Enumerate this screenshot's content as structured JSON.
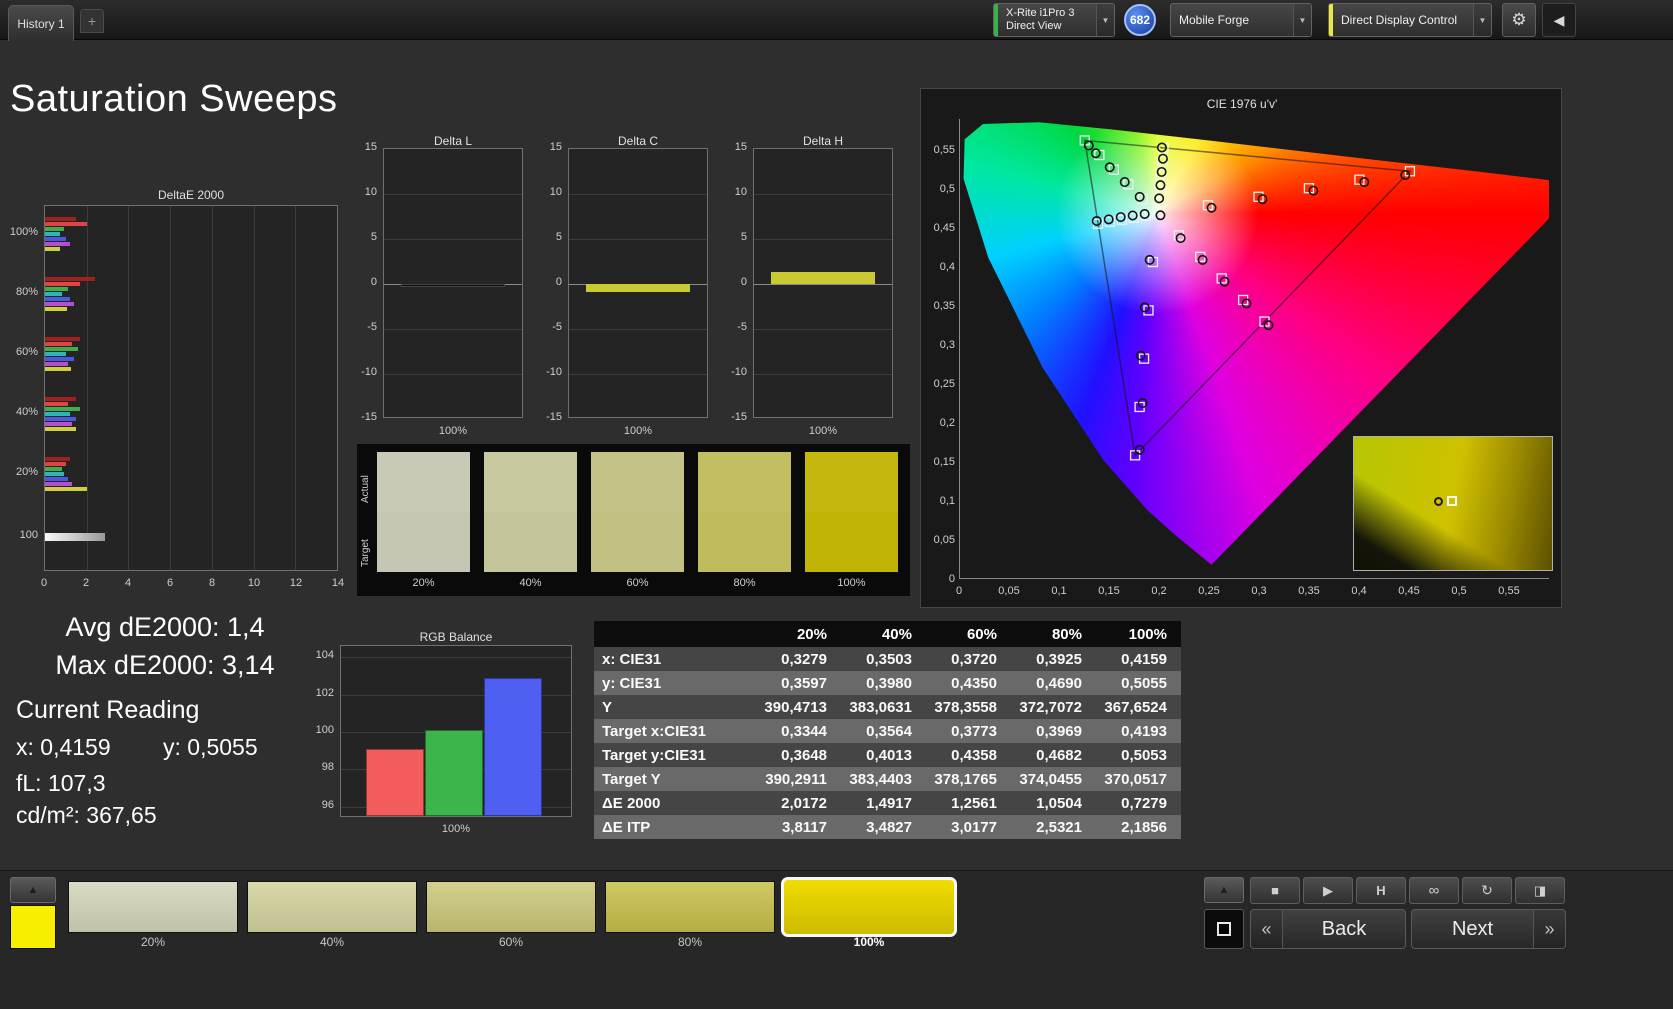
{
  "icons": {
    "plus": "+",
    "caret_down": "▼",
    "gear": "⚙",
    "collapse_left": "◀",
    "up_arrow": "▲",
    "stop": "■",
    "play": "▶",
    "histogram": "H",
    "continuous": "∞",
    "refresh": "↻",
    "half_square": "◨",
    "back_chevron": "«",
    "next_chevron": "»"
  },
  "top_bar": {
    "tab": "History 1",
    "meter": {
      "line1": "X-Rite i1Pro 3",
      "line2": "Direct View",
      "accent": "#35b44a"
    },
    "badge": "682",
    "source": {
      "label": "Mobile Forge"
    },
    "control": {
      "label": "Direct Display Control",
      "accent": "#e8e840"
    }
  },
  "page": {
    "title": "Saturation Sweeps"
  },
  "chart_data": [
    {
      "type": "bar",
      "title": "DeltaE 2000",
      "orientation": "horizontal",
      "groups": [
        "100%",
        "80%",
        "60%",
        "40%",
        "20%",
        "100"
      ],
      "series_colors": [
        "#a01f1f",
        "#e04545",
        "#3fae4a",
        "#2fb5b5",
        "#4a5ae0",
        "#b44fd0",
        "#cfcf40"
      ],
      "values": [
        [
          1.5,
          2.0,
          0.9,
          0.7,
          1.0,
          1.2,
          0.73
        ],
        [
          2.4,
          1.7,
          1.1,
          0.8,
          1.2,
          1.4,
          1.05
        ],
        [
          1.7,
          1.3,
          1.6,
          1.0,
          1.4,
          1.1,
          1.26
        ],
        [
          1.5,
          1.1,
          1.7,
          1.2,
          1.5,
          1.3,
          1.49
        ],
        [
          1.2,
          1.0,
          0.8,
          0.9,
          1.1,
          1.3,
          2.02
        ],
        [
          2.9
        ]
      ],
      "xlim": [
        0,
        14
      ],
      "xticks": [
        0,
        2,
        4,
        6,
        8,
        10,
        12,
        14
      ]
    },
    {
      "type": "bar",
      "title": "Delta L",
      "value": -0.3,
      "color": "#0c0c0c",
      "outline": true,
      "ylim": [
        -15,
        15
      ],
      "yticks": [
        15,
        10,
        5,
        0,
        -5,
        -10,
        -15
      ],
      "xlabel": "100%"
    },
    {
      "type": "bar",
      "title": "Delta C",
      "value": -0.9,
      "color": "#c9c932",
      "outline": false,
      "ylim": [
        -15,
        15
      ],
      "yticks": [
        15,
        10,
        5,
        0,
        -5,
        -10,
        -15
      ],
      "xlabel": "100%"
    },
    {
      "type": "bar",
      "title": "Delta H",
      "value": 1.3,
      "color": "#c9c932",
      "outline": false,
      "ylim": [
        -15,
        15
      ],
      "yticks": [
        15,
        10,
        5,
        0,
        -5,
        -10,
        -15
      ],
      "xlabel": "100%"
    },
    {
      "type": "bar",
      "title": "RGB Balance",
      "categories": [
        "Red",
        "Green",
        "Blue"
      ],
      "values": [
        99,
        100,
        102.8
      ],
      "colors": [
        "#f25c5c",
        "#3cb54a",
        "#4f5ff2"
      ],
      "ylim": [
        96,
        104
      ],
      "yticks": [
        96,
        98,
        100,
        102,
        104
      ],
      "xlabel": "100%"
    },
    {
      "type": "scatter",
      "title": "CIE 1976 u'v'",
      "xlim": [
        0,
        0.59
      ],
      "ylim": [
        0,
        0.59
      ],
      "tick_values": [
        0,
        0.05,
        0.1,
        0.15,
        0.2,
        0.25,
        0.3,
        0.35,
        0.4,
        0.45,
        0.5,
        0.55
      ],
      "tick_labels": [
        "0",
        "0,05",
        "0,1",
        "0,15",
        "0,2",
        "0,25",
        "0,3",
        "0,35",
        "0,4",
        "0,45",
        "0,5",
        "0,55"
      ],
      "white_point": [
        0.1978,
        0.4683
      ],
      "gamut_triangle": [
        [
          0.4507,
          0.5229
        ],
        [
          0.125,
          0.5625
        ],
        [
          0.1754,
          0.1579
        ]
      ],
      "sweeps": [
        {
          "name": "red",
          "targets": [
            [
              0.2484,
              0.4792
            ],
            [
              0.299,
              0.4901
            ],
            [
              0.3495,
              0.5011
            ],
            [
              0.4001,
              0.512
            ],
            [
              0.4507,
              0.5229
            ]
          ],
          "measured": [
            [
              0.252,
              0.476
            ],
            [
              0.303,
              0.487
            ],
            [
              0.354,
              0.498
            ],
            [
              0.405,
              0.509
            ],
            [
              0.446,
              0.518
            ]
          ]
        },
        {
          "name": "green",
          "targets": [
            [
              0.1832,
              0.4871
            ],
            [
              0.1687,
              0.506
            ],
            [
              0.1541,
              0.5248
            ],
            [
              0.1396,
              0.5437
            ],
            [
              0.125,
              0.5625
            ]
          ],
          "measured": [
            [
              0.18,
              0.49
            ],
            [
              0.165,
              0.509
            ],
            [
              0.15,
              0.528
            ],
            [
              0.136,
              0.546
            ],
            [
              0.129,
              0.556
            ]
          ]
        },
        {
          "name": "blue",
          "targets": [
            [
              0.1933,
              0.4062
            ],
            [
              0.1888,
              0.3441
            ],
            [
              0.1844,
              0.2821
            ],
            [
              0.1799,
              0.22
            ],
            [
              0.1754,
              0.1579
            ]
          ],
          "measured": [
            [
              0.19,
              0.409
            ],
            [
              0.185,
              0.348
            ],
            [
              0.181,
              0.286
            ],
            [
              0.183,
              0.225
            ],
            [
              0.18,
              0.165
            ]
          ]
        },
        {
          "name": "cyan",
          "targets": [
            [
              0.1859,
              0.4657
            ],
            [
              0.174,
              0.4631
            ],
            [
              0.1621,
              0.4606
            ],
            [
              0.1502,
              0.458
            ],
            [
              0.1383,
              0.4554
            ]
          ],
          "measured": [
            [
              0.185,
              0.468
            ],
            [
              0.173,
              0.466
            ],
            [
              0.161,
              0.464
            ],
            [
              0.149,
              0.461
            ],
            [
              0.137,
              0.459
            ]
          ]
        },
        {
          "name": "magenta",
          "targets": [
            [
              0.2192,
              0.4406
            ],
            [
              0.2407,
              0.4129
            ],
            [
              0.2621,
              0.3852
            ],
            [
              0.2836,
              0.3575
            ],
            [
              0.305,
              0.3298
            ]
          ],
          "measured": [
            [
              0.221,
              0.437
            ],
            [
              0.243,
              0.409
            ],
            [
              0.265,
              0.381
            ],
            [
              0.287,
              0.353
            ],
            [
              0.309,
              0.325
            ]
          ]
        },
        {
          "name": "yellow",
          "targets": [
            [
              0.199,
              0.4852
            ],
            [
              0.2002,
              0.5021
            ],
            [
              0.2015,
              0.5191
            ],
            [
              0.2027,
              0.536
            ],
            [
              0.2039,
              0.5529
            ]
          ],
          "measured": [
            [
              0.1995,
              0.488
            ],
            [
              0.2008,
              0.505
            ],
            [
              0.202,
              0.522
            ],
            [
              0.2033,
              0.539
            ],
            [
              0.2023,
              0.5534
            ]
          ]
        }
      ]
    }
  ],
  "swatch_strip": {
    "row_labels": [
      "Actual",
      "Target"
    ],
    "items": [
      {
        "label": "20%",
        "actual": "#c9cab6",
        "target": "#c6c7b2"
      },
      {
        "label": "40%",
        "actual": "#c8c8a0",
        "target": "#c5c59c"
      },
      {
        "label": "60%",
        "actual": "#c5c287",
        "target": "#c2c083"
      },
      {
        "label": "80%",
        "actual": "#c3be62",
        "target": "#c0bb5c"
      },
      {
        "label": "100%",
        "actual": "#c6b70e",
        "target": "#c2b406"
      }
    ]
  },
  "readings": {
    "avg": "Avg dE2000: 1,4",
    "max": "Max dE2000: 3,14",
    "current_title": "Current Reading",
    "x": "x: 0,4159",
    "y": "y: 0,5055",
    "fl": "fL: 107,3",
    "cdm2": "cd/m²: 367,65"
  },
  "table": {
    "columns": [
      "",
      "20%",
      "40%",
      "60%",
      "80%",
      "100%"
    ],
    "rows": [
      {
        "label": "x: CIE31",
        "values": [
          "0,3279",
          "0,3503",
          "0,3720",
          "0,3925",
          "0,4159"
        ]
      },
      {
        "label": "y: CIE31",
        "values": [
          "0,3597",
          "0,3980",
          "0,4350",
          "0,4690",
          "0,5055"
        ]
      },
      {
        "label": "Y",
        "values": [
          "390,4713",
          "383,0631",
          "378,3558",
          "372,7072",
          "367,6524"
        ]
      },
      {
        "label": "Target x:CIE31",
        "values": [
          "0,3344",
          "0,3564",
          "0,3773",
          "0,3969",
          "0,4193"
        ]
      },
      {
        "label": "Target y:CIE31",
        "values": [
          "0,3648",
          "0,4013",
          "0,4358",
          "0,4682",
          "0,5053"
        ]
      },
      {
        "label": "Target Y",
        "values": [
          "390,2911",
          "383,4403",
          "378,1765",
          "374,0455",
          "370,0517"
        ]
      },
      {
        "label": "ΔE 2000",
        "values": [
          "2,0172",
          "1,4917",
          "1,2561",
          "1,0504",
          "0,7279"
        ]
      },
      {
        "label": "ΔE ITP",
        "values": [
          "3,8117",
          "3,4827",
          "3,0177",
          "2,5321",
          "2,1856"
        ]
      }
    ]
  },
  "bottom_bar": {
    "current_color": "#f8ee00",
    "items": [
      {
        "label": "20%",
        "c1": "#dadbc4",
        "c2": "#c0c1a8",
        "selected": false
      },
      {
        "label": "40%",
        "c1": "#d8d8ab",
        "c2": "#bfbf90",
        "selected": false
      },
      {
        "label": "60%",
        "c1": "#d3d08d",
        "c2": "#b9b56e",
        "selected": false
      },
      {
        "label": "80%",
        "c1": "#cfc964",
        "c2": "#b5ad45",
        "selected": false
      },
      {
        "label": "100%",
        "c1": "#f0dc02",
        "c2": "#cdbb00",
        "selected": true
      }
    ],
    "back": "Back",
    "next": "Next"
  }
}
